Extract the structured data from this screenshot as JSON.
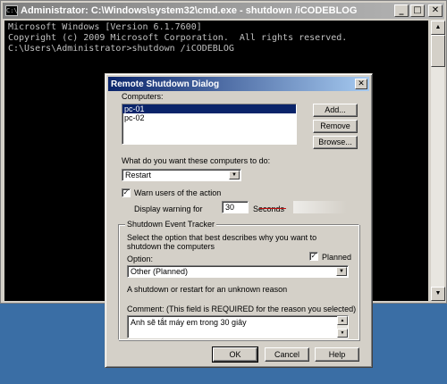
{
  "cmd": {
    "title": "Administrator: C:\\Windows\\system32\\cmd.exe - shutdown  /iCODEBLOG",
    "icon_text": "C:\\",
    "lines": [
      "Microsoft Windows [Version 6.1.7600]",
      "Copyright (c) 2009 Microsoft Corporation.  All rights reserved.",
      "",
      "C:\\Users\\Administrator>shutdown /iCODEBLOG"
    ],
    "controls": {
      "minimize": "_",
      "maximize": "□",
      "close": "✕"
    }
  },
  "dialog": {
    "title": "Remote Shutdown Dialog",
    "close": "✕",
    "computers_label": "Computers:",
    "computers": [
      {
        "name": "pc-01",
        "selected": true
      },
      {
        "name": "pc-02",
        "selected": false
      }
    ],
    "add_button": "Add...",
    "remove_button": "Remove",
    "browse_button": "Browse...",
    "action_label": "What do you want these computers to do:",
    "action_value": "Restart",
    "warn_checkbox_label": "Warn users of the action",
    "warn_checked": true,
    "display_warning_label": "Display warning for",
    "warning_seconds": "30",
    "seconds_label": "Seconds",
    "tracker": {
      "title": "Shutdown Event Tracker",
      "description": "Select the option that best describes why you want to shutdown the computers",
      "option_label": "Option:",
      "planned_label": "Planned",
      "planned_checked": true,
      "option_value": "Other (Planned)",
      "option_description": "A shutdown or restart for an unknown reason",
      "comment_label": "Comment: (This field is REQUIRED for the reason you selected)",
      "comment_value": "Anh sẽ tắt máy em trong 30 giây"
    },
    "ok_button": "OK",
    "cancel_button": "Cancel",
    "help_button": "Help"
  },
  "colors": {
    "desktop": "#3a6ea5",
    "active_title": "#0a246a",
    "inactive_title": "#808080",
    "selection": "#0a246a"
  },
  "icons": {
    "dropdown": "chevron-down-icon",
    "check": "checkmark-icon",
    "scroll_up": "arrow-up-icon",
    "scroll_down": "arrow-down-icon"
  }
}
